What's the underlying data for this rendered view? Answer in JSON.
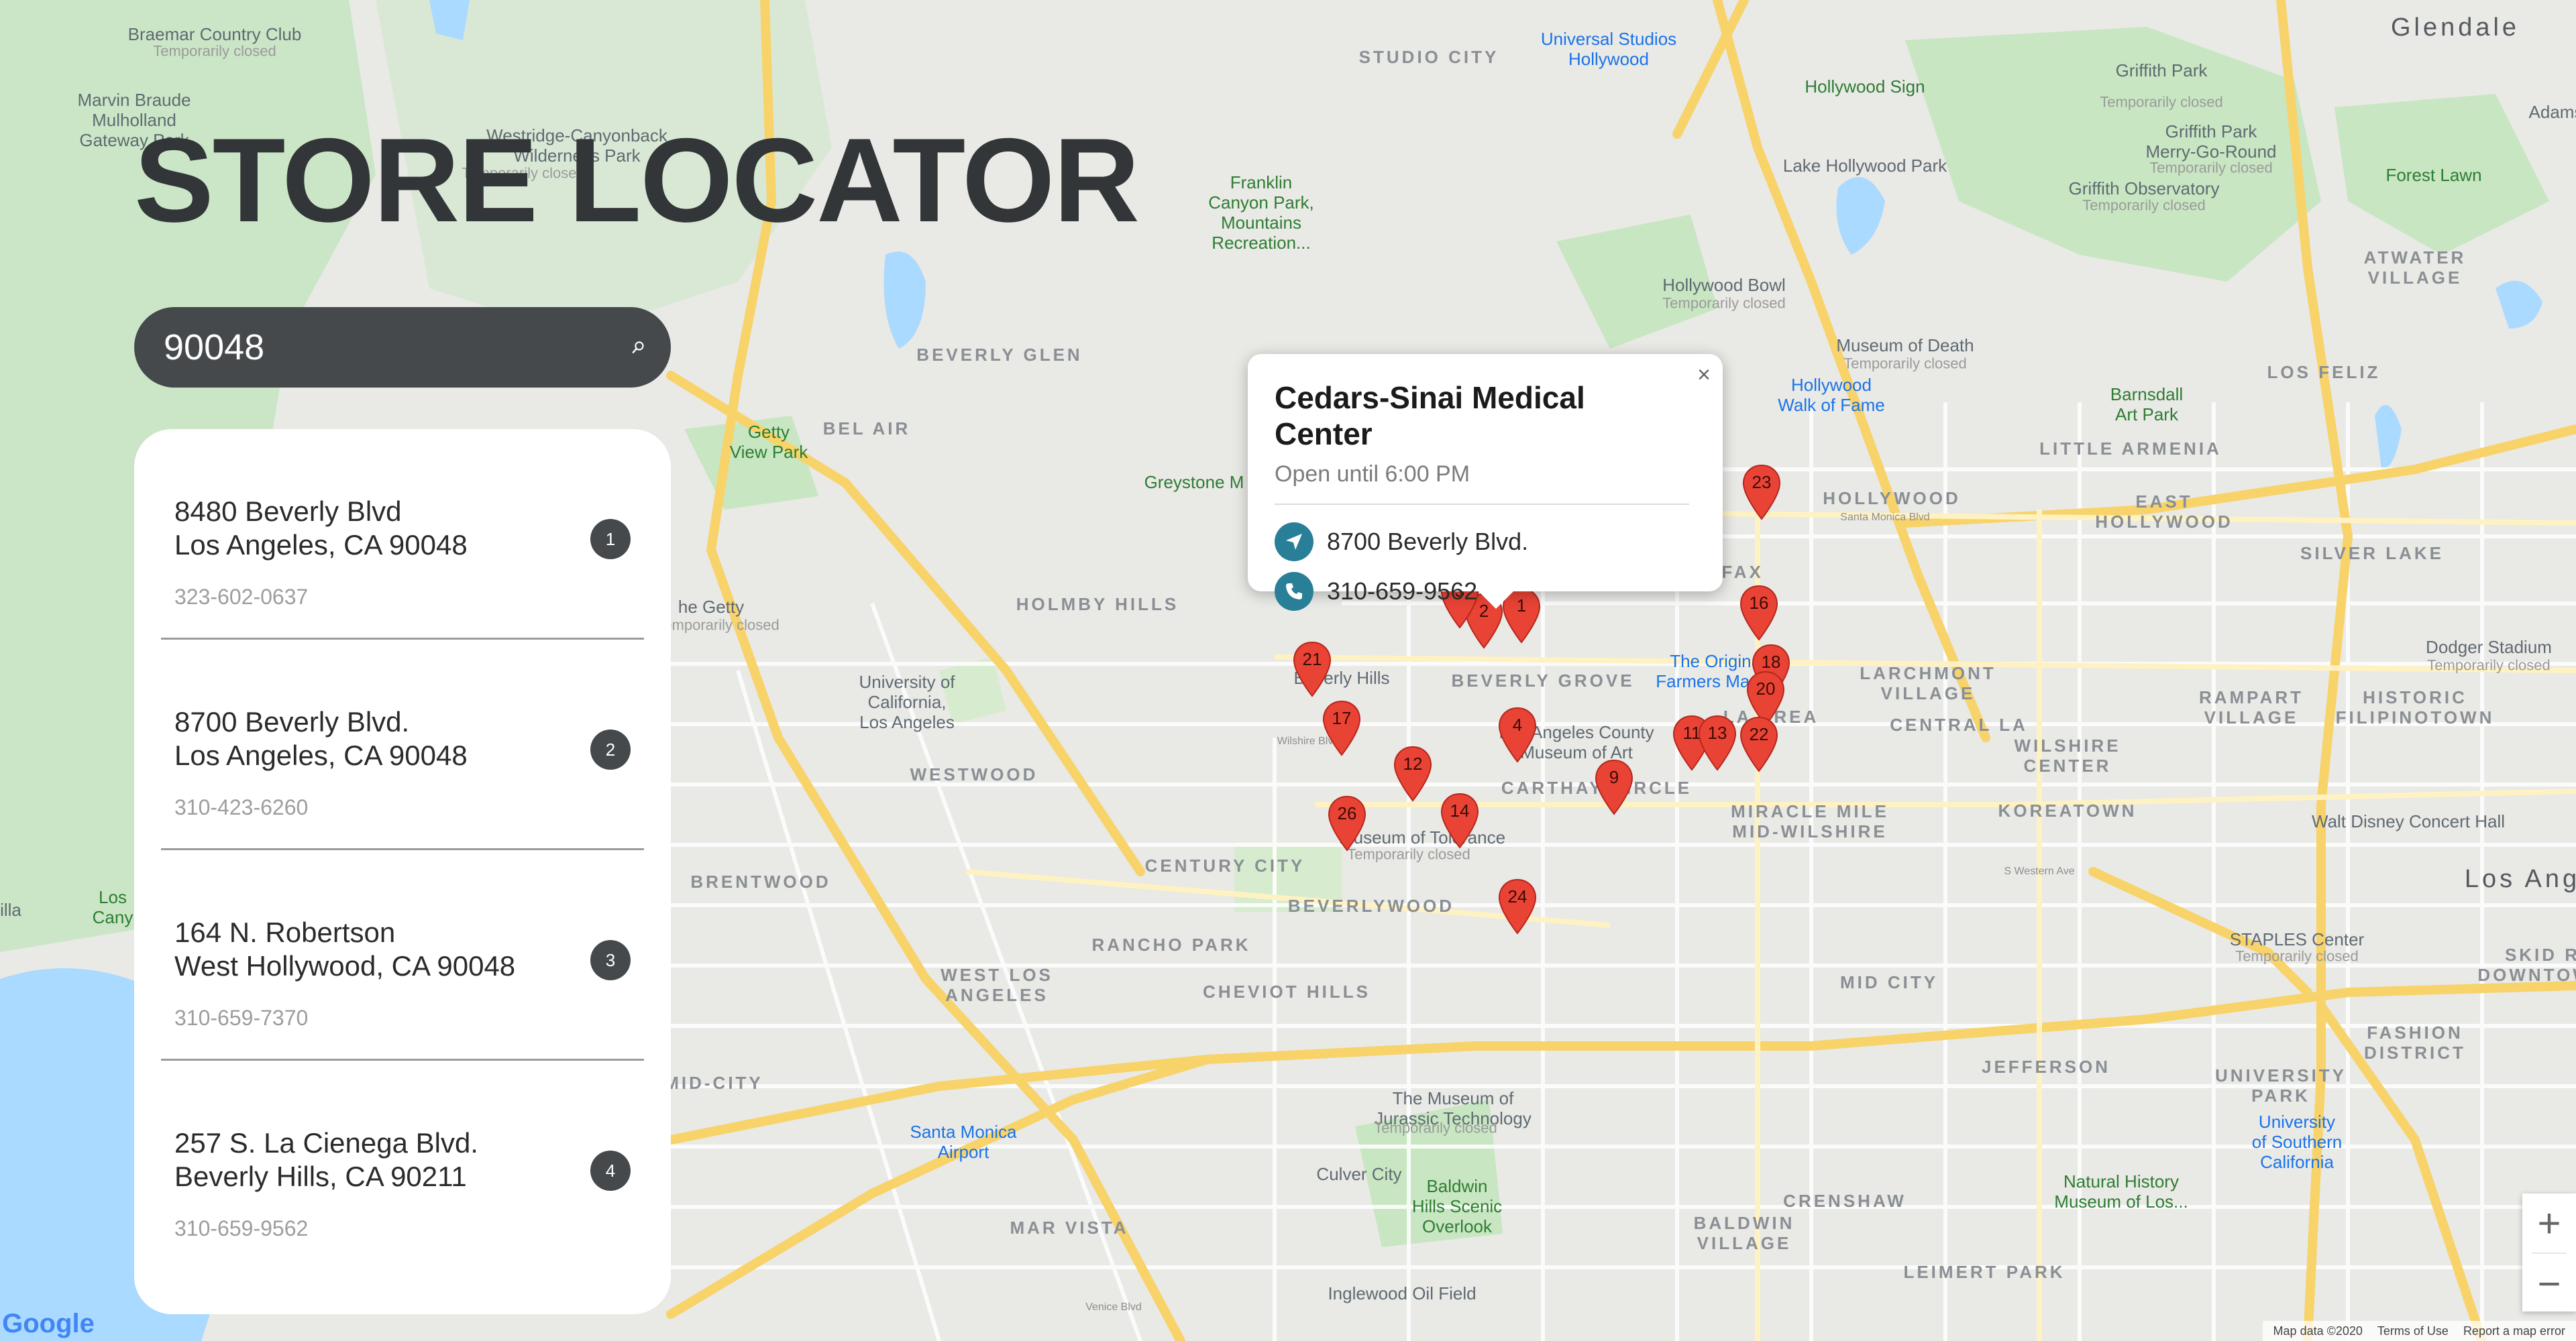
{
  "page": {
    "title": "STORE LOCATOR"
  },
  "search": {
    "value": "90048",
    "placeholder": ""
  },
  "results": [
    {
      "index": "1",
      "line1": "8480 Beverly Blvd",
      "line2": "Los Angeles, CA 90048",
      "phone": "323-602-0637"
    },
    {
      "index": "2",
      "line1": "8700 Beverly Blvd.",
      "line2": "Los Angeles, CA 90048",
      "phone": "310-423-6260"
    },
    {
      "index": "3",
      "line1": "164 N. Robertson",
      "line2": "West Hollywood, CA 90048",
      "phone": "310-659-7370"
    },
    {
      "index": "4",
      "line1": "257 S. La Cienega Blvd.",
      "line2": "Beverly Hills, CA 90211",
      "phone": "310-659-9562"
    }
  ],
  "infowindow": {
    "title": "Cedars-Sinai Medical Center",
    "status": "Open until 6:00 PM",
    "address": "8700 Beverly Blvd.",
    "phone": "310-659-9562",
    "close_label": "×",
    "address_icon": "navigation-arrow-icon",
    "phone_icon": "phone-icon"
  },
  "map": {
    "markers": [
      "1",
      "2",
      "3",
      "4",
      "9",
      "11",
      "12",
      "13",
      "14",
      "16",
      "17",
      "18",
      "20",
      "21",
      "22",
      "23",
      "24",
      "26"
    ],
    "labels": {
      "braemar": "Braemar Country Club",
      "braemar_sub": "Temporarily closed",
      "marvin": "Marvin Braude\nMulholland\nGateway Park",
      "westridge": "Westridge-Canyonback\nWilderness Park",
      "westridge_sub": "Temporarily closed",
      "studio_city": "STUDIO CITY",
      "universal": "Universal Studios\nHollywood",
      "hollywood_sign": "Hollywood Sign",
      "griffith_park": "Griffith Park",
      "griffith_park_sub": "Temporarily closed",
      "glendale": "Glendale",
      "adams": "Adams",
      "franklin": "Franklin\nCanyon Park,\nMountains\nRecreation...",
      "lake_hollywood": "Lake Hollywood Park",
      "griffith_obs": "Griffith Observatory",
      "griffith_obs_sub": "Temporarily closed",
      "merry_go_round": "Griffith Park\nMerry-Go-Round",
      "merry_sub": "Temporarily closed",
      "forest_lawn": "Forest Lawn",
      "atwater": "ATWATER\nVILLAGE",
      "beverly_glen": "BEVERLY GLEN",
      "hollywood_bowl": "Hollywood Bowl",
      "hollywood_bowl_sub": "Temporarily closed",
      "museum_death": "Museum of Death",
      "museum_death_sub": "Temporarily closed",
      "walk_of_fame": "Hollywood\nWalk of Fame",
      "los_feliz": "LOS FELIZ",
      "barnsdall": "Barnsdall\nArt Park",
      "little_armenia": "LITTLE ARMENIA",
      "bel_air": "BEL AIR",
      "getty_view": "Getty\nView Park",
      "greystone": "Greystone M",
      "hollywood": "HOLLYWOOD",
      "east_hollywood": "EAST\nHOLLYWOOD",
      "silver_lake": "SILVER LAKE",
      "santa_monica_blvd": "Santa Monica Blvd",
      "holmby_hills": "HOLMBY HILLS",
      "fairfax": "FAIRFAX",
      "larchmont": "LARCHMONT\nVILLAGE",
      "dodger": "Dodger Stadium",
      "dodger_sub": "Temporarily closed",
      "beverly_hills": "Beverly Hills",
      "beverly_grove": "BEVERLY GROVE",
      "original_farmers": "The Original\nFarmers Market",
      "ucla": "University of\nCalifornia,\nLos Angeles",
      "la_brea": "LA BREA",
      "central_la": "CENTRAL LA",
      "ramparts": "RAMPART\nVILLAGE",
      "historic_filipinotown": "HISTORIC\nFILIPINOTOWN",
      "lacma": "Los Angeles County\nMuseum of Art",
      "westwood": "WESTWOOD",
      "carthay": "CARTHAY CIRCLE",
      "miracle_mile": "MIRACLE MILE\nMID-WILSHIRE",
      "wilshire_center": "WILSHIRE\nCENTER",
      "koreatown": "KOREATOWN",
      "walt_disney": "Walt Disney Concert Hall",
      "museum_tolerance": "Museum of Tolerance",
      "museum_tolerance_sub": "Temporarily closed",
      "century_city": "CENTURY CITY",
      "brentwood": "BRENTWOOD",
      "beverlywood": "BEVERLYWOOD",
      "los_angeles": "Los Ang",
      "rancho_park": "RANCHO PARK",
      "staples": "STAPLES Center",
      "staples_sub": "Temporarily closed",
      "skid_row": "SKID R\nDOWNTOWN",
      "west_la": "WEST LOS\nANGELES",
      "cheviot": "CHEVIOT HILLS",
      "mid_city": "MID CITY",
      "fashion": "FASHION\nDISTRICT",
      "mid_city_west": "MID-CITY",
      "jefferson": "JEFFERSON",
      "university_park": "UNIVERSITY\nPARK",
      "jurassic": "The Museum of\nJurassic Technology",
      "jurassic_sub": "Temporarily closed",
      "usc": "University\nof Southern\nCalifornia",
      "santa_monica_airport": "Santa Monica\nAirport",
      "culver_city": "Culver City",
      "crenshaw": "CRENSHAW",
      "natural_history": "Natural History\nMuseum of Los...",
      "baldwin_hills": "Baldwin\nHills Scenic\nOverlook",
      "mar_vista": "MAR VISTA",
      "baldwin_village": "BALDWIN\nVILLAGE",
      "leimert": "LEIMERT PARK",
      "inglewood_oil": "Inglewood Oil Field",
      "getty_center": "he Getty",
      "getty_sub": "Temporarily closed",
      "los_cany": "Los\nCany",
      "villa": "illa",
      "western_ave": "S Western Ave",
      "wilshire_blvd": "Wilshire Blvd",
      "venice_blvd": "Venice Blvd",
      "google": "Google"
    },
    "footer": {
      "map_data": "Map data ©2020",
      "terms": "Terms of Use",
      "report": "Report a map error"
    },
    "zoom": {
      "in_label": "+",
      "out_label": "−"
    },
    "colors": {
      "land": "#e9e9e6",
      "park": "#c8e6c2",
      "water": "#aadaff",
      "highway": "#f8d36a",
      "pin": "#e94335",
      "panel_dark": "#45494c",
      "info_icon": "#2a7f98"
    }
  }
}
